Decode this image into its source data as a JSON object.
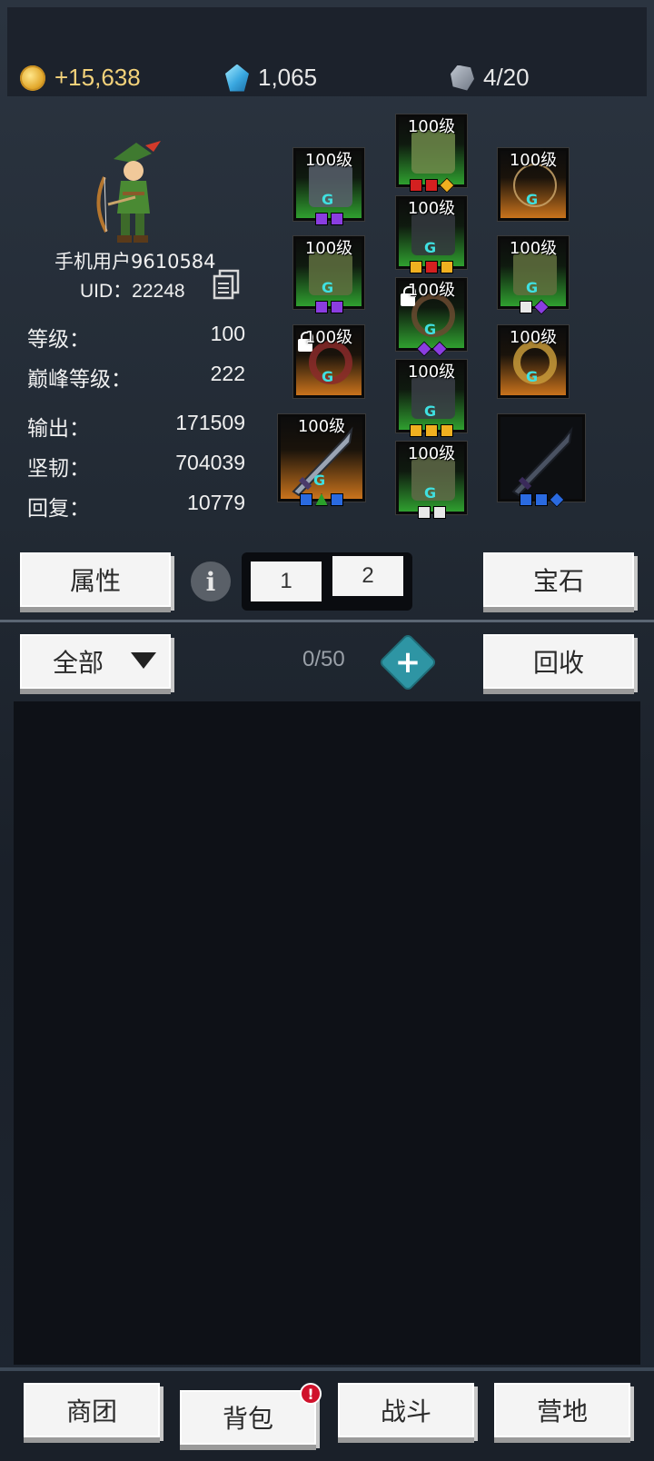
{
  "currency": {
    "gold": "+15,638",
    "gems": "1,065",
    "ore": "4/20",
    "colors": {
      "gold": "#f3d27a",
      "text": "#f0f0f0"
    }
  },
  "player": {
    "name": "手机用户9610584",
    "uid_label": "UID：22248",
    "stats": [
      {
        "label": "等级：",
        "value": "100"
      },
      {
        "label": "巅峰等级：",
        "value": "222"
      },
      {
        "label": "输出：",
        "value": "171509"
      },
      {
        "label": "坚韧：",
        "value": "704039"
      },
      {
        "label": "回复：",
        "value": "10779"
      }
    ]
  },
  "equipment": [
    {
      "name": "helmet",
      "level": "100级",
      "rarity": "green",
      "sockets": [
        "red",
        "red",
        "yellow"
      ]
    },
    {
      "name": "shoulder",
      "level": "100级",
      "rarity": "green",
      "sockets": [
        "purple",
        "purple"
      ]
    },
    {
      "name": "necklace",
      "level": "100级",
      "rarity": "orange",
      "sockets": []
    },
    {
      "name": "chest",
      "level": "100级",
      "rarity": "green",
      "sockets": [
        "yellow",
        "red",
        "yellow"
      ]
    },
    {
      "name": "gloves",
      "level": "100级",
      "rarity": "green",
      "sockets": [
        "purple",
        "purple"
      ]
    },
    {
      "name": "bracer",
      "level": "100级",
      "rarity": "green",
      "sockets": [
        "white",
        "purple"
      ]
    },
    {
      "name": "belt",
      "level": "100级",
      "rarity": "green",
      "sockets": [
        "purple",
        "purple"
      ]
    },
    {
      "name": "ring-left",
      "level": "100级",
      "rarity": "orange",
      "sockets": []
    },
    {
      "name": "ring-right",
      "level": "100级",
      "rarity": "orange",
      "sockets": []
    },
    {
      "name": "pants",
      "level": "100级",
      "rarity": "green",
      "sockets": [
        "yellow",
        "yellow",
        "yellow"
      ]
    },
    {
      "name": "main-weapon",
      "level": "100级",
      "rarity": "orange",
      "sockets": [
        "blue",
        "green",
        "blue"
      ]
    },
    {
      "name": "boots",
      "level": "100级",
      "rarity": "green",
      "sockets": [
        "white",
        "white"
      ]
    },
    {
      "name": "offhand-weapon",
      "level": "",
      "rarity": "dark",
      "sockets": [
        "blue",
        "blue",
        "blue"
      ]
    }
  ],
  "controls": {
    "attributes_label": "属性",
    "info_label": "i",
    "page1": "1",
    "page2": "2",
    "gems_label": "宝石",
    "filter_label": "全部",
    "capacity": "0/50",
    "recycle_label": "回收"
  },
  "nav": {
    "items": [
      "商团",
      "背包",
      "战斗",
      "营地"
    ],
    "badge": "!"
  }
}
